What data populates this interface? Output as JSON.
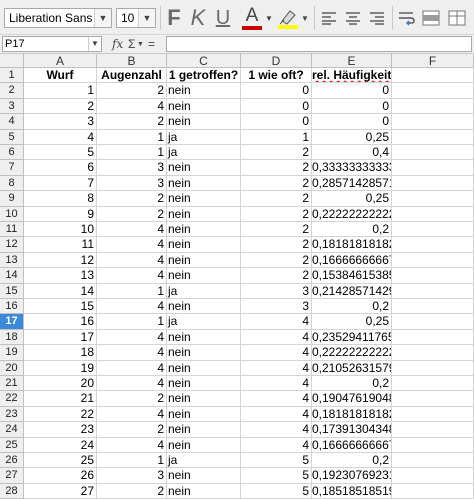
{
  "toolbar": {
    "font_name": "Liberation Sans",
    "font_size": "10",
    "bold_label": "F",
    "italic_label": "K",
    "underline_label": "U",
    "font_color_label": "A",
    "font_color": "#cc0000",
    "highlight_color": "#ffff00"
  },
  "formula_bar": {
    "name_box": "P17",
    "fx_label": "fx",
    "sum_label": "Σ",
    "eq_label": "=",
    "content": ""
  },
  "columns": [
    "",
    "A",
    "B",
    "C",
    "D",
    "E",
    "F"
  ],
  "headers": [
    "Wurf",
    "Augenzahl",
    "1 getroffen?",
    "1 wie oft?",
    "rel. Häufigkeit"
  ],
  "selected_row": "17",
  "rows": [
    {
      "n": "2",
      "a": "1",
      "b": "2",
      "c": "nein",
      "d": "0",
      "e": "0"
    },
    {
      "n": "3",
      "a": "2",
      "b": "4",
      "c": "nein",
      "d": "0",
      "e": "0"
    },
    {
      "n": "4",
      "a": "3",
      "b": "2",
      "c": "nein",
      "d": "0",
      "e": "0"
    },
    {
      "n": "5",
      "a": "4",
      "b": "1",
      "c": "ja",
      "d": "1",
      "e": "0,25"
    },
    {
      "n": "6",
      "a": "5",
      "b": "1",
      "c": "ja",
      "d": "2",
      "e": "0,4"
    },
    {
      "n": "7",
      "a": "6",
      "b": "3",
      "c": "nein",
      "d": "2",
      "e": "0,33333333333"
    },
    {
      "n": "8",
      "a": "7",
      "b": "3",
      "c": "nein",
      "d": "2",
      "e": "0,28571428571"
    },
    {
      "n": "9",
      "a": "8",
      "b": "2",
      "c": "nein",
      "d": "2",
      "e": "0,25"
    },
    {
      "n": "10",
      "a": "9",
      "b": "2",
      "c": "nein",
      "d": "2",
      "e": "0,22222222222"
    },
    {
      "n": "11",
      "a": "10",
      "b": "4",
      "c": "nein",
      "d": "2",
      "e": "0,2"
    },
    {
      "n": "12",
      "a": "11",
      "b": "4",
      "c": "nein",
      "d": "2",
      "e": "0,18181818182"
    },
    {
      "n": "13",
      "a": "12",
      "b": "4",
      "c": "nein",
      "d": "2",
      "e": "0,16666666667"
    },
    {
      "n": "14",
      "a": "13",
      "b": "4",
      "c": "nein",
      "d": "2",
      "e": "0,15384615385"
    },
    {
      "n": "15",
      "a": "14",
      "b": "1",
      "c": "ja",
      "d": "3",
      "e": "0,21428571429"
    },
    {
      "n": "16",
      "a": "15",
      "b": "4",
      "c": "nein",
      "d": "3",
      "e": "0,2"
    },
    {
      "n": "17",
      "a": "16",
      "b": "1",
      "c": "ja",
      "d": "4",
      "e": "0,25"
    },
    {
      "n": "18",
      "a": "17",
      "b": "4",
      "c": "nein",
      "d": "4",
      "e": "0,23529411765"
    },
    {
      "n": "19",
      "a": "18",
      "b": "4",
      "c": "nein",
      "d": "4",
      "e": "0,22222222222"
    },
    {
      "n": "20",
      "a": "19",
      "b": "4",
      "c": "nein",
      "d": "4",
      "e": "0,21052631579"
    },
    {
      "n": "21",
      "a": "20",
      "b": "4",
      "c": "nein",
      "d": "4",
      "e": "0,2"
    },
    {
      "n": "22",
      "a": "21",
      "b": "2",
      "c": "nein",
      "d": "4",
      "e": "0,19047619048"
    },
    {
      "n": "23",
      "a": "22",
      "b": "4",
      "c": "nein",
      "d": "4",
      "e": "0,18181818182"
    },
    {
      "n": "24",
      "a": "23",
      "b": "2",
      "c": "nein",
      "d": "4",
      "e": "0,17391304348"
    },
    {
      "n": "25",
      "a": "24",
      "b": "4",
      "c": "nein",
      "d": "4",
      "e": "0,16666666667"
    },
    {
      "n": "26",
      "a": "25",
      "b": "1",
      "c": "ja",
      "d": "5",
      "e": "0,2"
    },
    {
      "n": "27",
      "a": "26",
      "b": "3",
      "c": "nein",
      "d": "5",
      "e": "0,19230769231"
    },
    {
      "n": "28",
      "a": "27",
      "b": "2",
      "c": "nein",
      "d": "5",
      "e": "0,18518518519"
    }
  ]
}
